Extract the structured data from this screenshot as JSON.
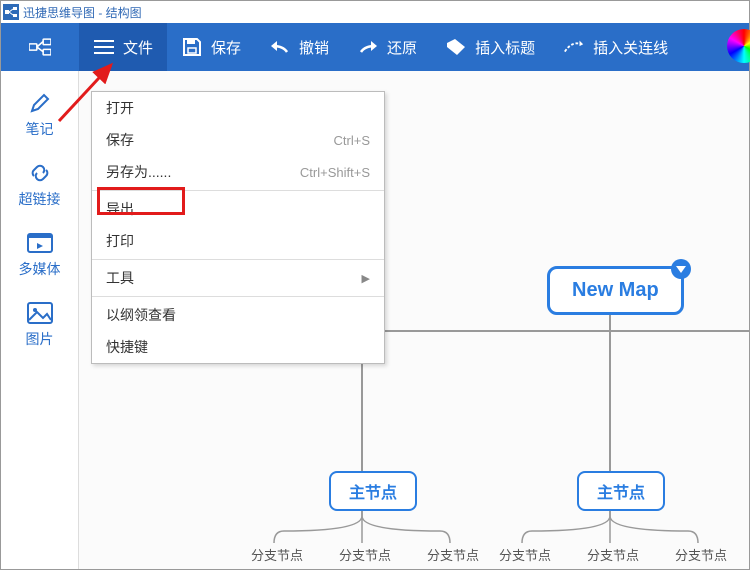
{
  "title": "迅捷思维导图 - 结构图",
  "toolbar": {
    "file": "文件",
    "save": "保存",
    "undo": "撤销",
    "redo": "还原",
    "insert_title": "插入标题",
    "insert_relation": "插入关连线"
  },
  "sidebar": {
    "note": "笔记",
    "hyperlink": "超链接",
    "media": "多媒体",
    "image": "图片"
  },
  "menu": {
    "open": "打开",
    "save": "保存",
    "save_shortcut": "Ctrl+S",
    "save_as": "另存为......",
    "save_as_shortcut": "Ctrl+Shift+S",
    "export": "导出",
    "print": "打印",
    "tools": "工具",
    "outline": "以纲领查看",
    "shortcuts": "快捷键"
  },
  "map": {
    "root": "New Map",
    "main_node": "主节点",
    "branch_node": "分支节点"
  }
}
